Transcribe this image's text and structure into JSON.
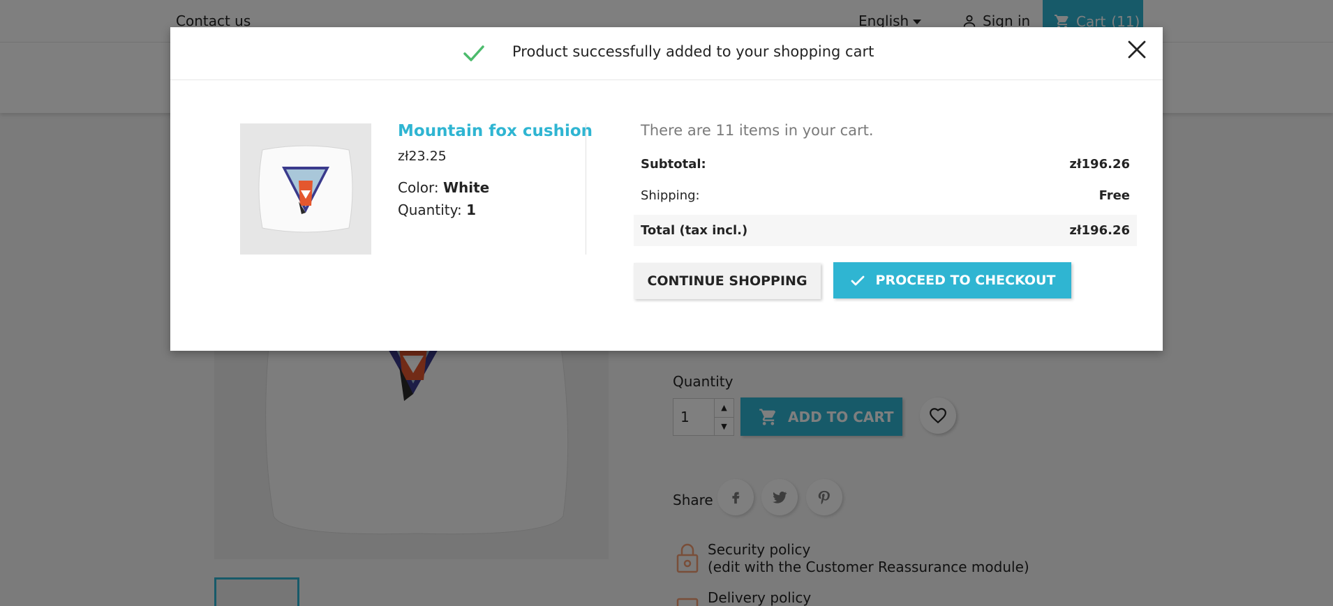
{
  "topbar": {
    "contact_label": "Contact us",
    "language_label": "English",
    "signin_label": "Sign in",
    "cart_label": "Cart",
    "cart_count": "(11)"
  },
  "product_page": {
    "quantity_label": "Quantity",
    "quantity_value": "1",
    "add_to_cart_label": "ADD TO CART",
    "share_label": "Share",
    "reassurance": [
      {
        "title": "Security policy",
        "subtitle": "(edit with the Customer Reassurance module)"
      },
      {
        "title": "Delivery policy"
      }
    ]
  },
  "modal": {
    "header_title": "Product successfully added to your shopping cart",
    "product": {
      "name": "Mountain fox cushion",
      "price": "zł23.25",
      "color_label": "Color:",
      "color_value": "White",
      "quantity_label": "Quantity:",
      "quantity_value": "1"
    },
    "summary": {
      "items_text": "There are 11 items in your cart.",
      "subtotal_label": "Subtotal:",
      "subtotal_value": "zł196.26",
      "shipping_label": "Shipping:",
      "shipping_value": "Free",
      "total_label": "Total (tax incl.)",
      "total_value": "zł196.26"
    },
    "continue_label": "CONTINUE SHOPPING",
    "checkout_label": "PROCEED TO CHECKOUT"
  },
  "colors": {
    "accent": "#2fb5d2",
    "success": "#4cbb6c",
    "reassurance_icon": "#f39d72"
  },
  "icons": [
    "person-icon",
    "cart-icon",
    "caret-down-icon",
    "check-icon",
    "close-icon",
    "heart-icon",
    "facebook-icon",
    "twitter-icon",
    "pinterest-icon",
    "lock-icon"
  ]
}
